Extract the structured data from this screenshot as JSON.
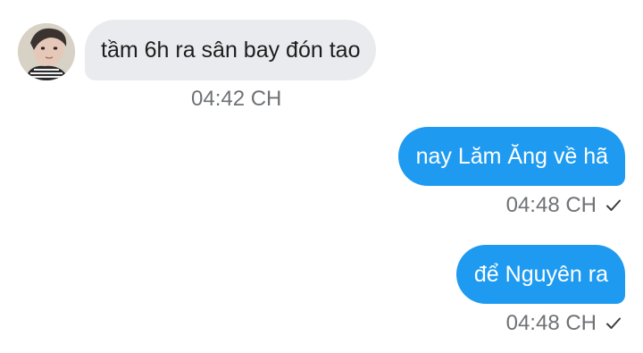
{
  "messages": [
    {
      "direction": "incoming",
      "text": "tầm 6h ra sân bay đón tao",
      "time": "04:42 CH"
    },
    {
      "direction": "outgoing",
      "text": "nay Lăm Ăng về hã",
      "time": "04:48 CH",
      "status_icon": "check-icon"
    },
    {
      "direction": "outgoing",
      "text": "để Nguyên ra",
      "time": "04:48 CH",
      "status_icon": "check-icon"
    }
  ],
  "colors": {
    "incoming_bubble": "#e9ebee",
    "outgoing_bubble": "#1e9bf0",
    "timestamp": "#6f7276"
  }
}
